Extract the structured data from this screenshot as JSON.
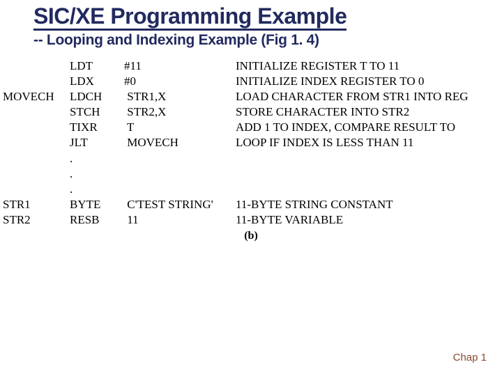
{
  "title": "SIC/XE Programming Example",
  "subtitle": "-- Looping and Indexing Example (Fig 1. 4)",
  "code": [
    {
      "label": "",
      "mnem": "LDT",
      "operand": "#11",
      "comment": "INITIALIZE REGISTER T TO 11"
    },
    {
      "label": "",
      "mnem": "LDX",
      "operand": "#0",
      "comment": "INITIALIZE INDEX REGISTER TO 0"
    },
    {
      "label": "MOVECH",
      "mnem": "LDCH",
      "operand": " STR1,X",
      "comment": "LOAD CHARACTER FROM STR1 INTO REG"
    },
    {
      "label": "",
      "mnem": "STCH",
      "operand": " STR2,X",
      "comment": "STORE CHARACTER INTO STR2"
    },
    {
      "label": "",
      "mnem": "TIXR",
      "operand": " T",
      "comment": "ADD 1 TO INDEX, COMPARE RESULT TO"
    },
    {
      "label": "",
      "mnem": "JLT",
      "operand": " MOVECH",
      "comment": "LOOP IF INDEX IS LESS THAN 11"
    },
    {
      "label": "",
      "mnem": ".",
      "operand": "",
      "comment": ""
    },
    {
      "label": "",
      "mnem": ".",
      "operand": "",
      "comment": ""
    },
    {
      "label": "",
      "mnem": ".",
      "operand": "",
      "comment": ""
    },
    {
      "label": "STR1",
      "mnem": "BYTE",
      "operand": " C'TEST STRING'",
      "comment": "11-BYTE STRING CONSTANT"
    },
    {
      "label": "STR2",
      "mnem": "RESB",
      "operand": " 11",
      "comment": "11-BYTE VARIABLE"
    }
  ],
  "figure_label": "(b)",
  "footer": "Chap 1"
}
